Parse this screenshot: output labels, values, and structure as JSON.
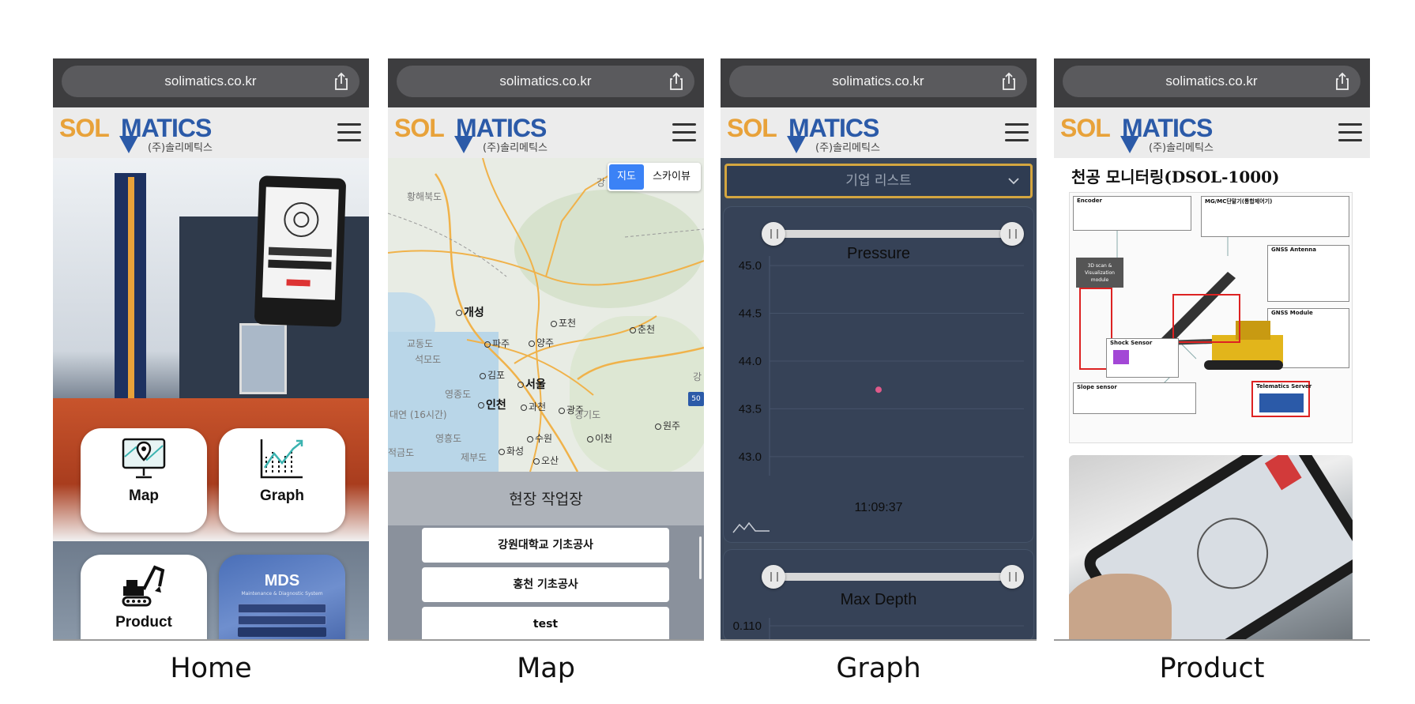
{
  "panels": {
    "home": {
      "caption": "Home",
      "url": "solimatics.co.kr",
      "logo_sub": "(주)솔리메틱스",
      "logo_sol": "SOL",
      "logo_matics": "MATICS",
      "tiles": [
        {
          "label": "Map",
          "icon": "map-pin-monitor-icon"
        },
        {
          "label": "Graph",
          "icon": "line-chart-icon"
        },
        {
          "label": "Product",
          "icon": "excavator-icon"
        },
        {
          "label": "MDS",
          "subtitle": "Maintenance & Diagnostic System"
        }
      ]
    },
    "map": {
      "caption": "Map",
      "url": "solimatics.co.kr",
      "logo_sub": "(주)솔리메틱스",
      "logo_sol": "SOL",
      "logo_matics": "MATICS",
      "map_type_buttons": [
        "지도",
        "스카이뷰"
      ],
      "selected_map_type": "지도",
      "map_labels": {
        "hwanghae": "황해북도",
        "gaeseong": "개성",
        "pocheon": "포천",
        "chuncheon": "춘천",
        "paju": "파주",
        "yangju": "양주",
        "gyodong": "교동도",
        "seokmo": "석모도",
        "gimpo": "김포",
        "seoul": "서울",
        "yeongjong": "영종도",
        "incheon": "인천",
        "gwacheon": "과천",
        "gwangju": "광주",
        "gyeonggi": "경기도",
        "daeyeon": "대연 (16시간)",
        "yeongheung": "영흥도",
        "suwon": "수원",
        "icheon": "이천",
        "hwaseong": "화성",
        "jebu": "제부도",
        "osan": "오산",
        "jeokgeum": "적금도",
        "wonju": "원주",
        "gang1": "강",
        "gang2": "강",
        "hwy": "50"
      },
      "sites_title": "현장 작업장",
      "sites": [
        "강원대학교 기초공사",
        "홍천 기초공사",
        "test"
      ]
    },
    "graph": {
      "caption": "Graph",
      "url": "solimatics.co.kr",
      "logo_sub": "(주)솔리메틱스",
      "logo_sol": "SOL",
      "logo_matics": "MATICS",
      "dropdown_placeholder": "기업 리스트",
      "charts": [
        {
          "title": "Pressure",
          "time_label": "11:09:37"
        },
        {
          "title": "Max Depth"
        }
      ]
    },
    "product": {
      "caption": "Product",
      "url": "solimatics.co.kr",
      "logo_sub": "(주)솔리메틱스",
      "logo_sol": "SOL",
      "logo_matics": "MATICS",
      "title": "천공 모니터링(DSOL-1000)",
      "diagram_labels": {
        "encoder": "Encoder",
        "mg_mc": "MG/MC단말기(통합제어기)",
        "gnss_antenna": "GNSS Antenna",
        "scan": "3D scan & Visualization module",
        "gnss_module": "GNSS Module",
        "shock_sensor": "Shock Sensor",
        "slope_sensor": "Slope sensor",
        "telematics": "Telematics Server"
      }
    }
  },
  "chart_data": [
    {
      "type": "scatter",
      "title": "Pressure",
      "x": [
        "11:09:37"
      ],
      "y": [
        43.7
      ],
      "yticks": [
        45.0,
        44.5,
        44.0,
        43.5,
        43.0
      ],
      "ylim": [
        42.8,
        45.1
      ],
      "point_color": "#e05a8a",
      "grid": true
    },
    {
      "type": "scatter",
      "title": "Max Depth",
      "yticks": [
        0.11
      ],
      "grid": true
    }
  ]
}
